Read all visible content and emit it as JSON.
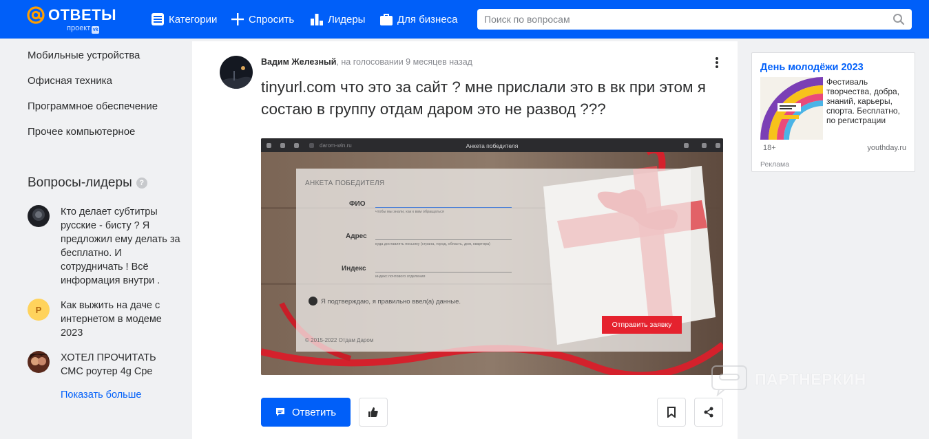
{
  "header": {
    "logo_text": "ОТВЕТЫ",
    "logo_sub": "проект",
    "logo_sub_badge": "vk",
    "nav": [
      {
        "label": "Категории",
        "icon": "categories-icon"
      },
      {
        "label": "Спросить",
        "icon": "plus-icon"
      },
      {
        "label": "Лидеры",
        "icon": "leaders-icon"
      },
      {
        "label": "Для бизнеса",
        "icon": "briefcase-icon"
      }
    ],
    "search_placeholder": "Поиск по вопросам",
    "search_value": ""
  },
  "sidebar": {
    "categories": [
      "Мобильные устройства",
      "Офисная техника",
      "Программное обеспечение",
      "Прочее компьютерное"
    ],
    "leaders_title": "Вопросы-лидеры",
    "help_mark": "?",
    "leaders": [
      {
        "text": "Кто делает субтитры русские - бисту ? Я предложил ему делать за бесплатно. И сотрудничать ! Всё информация внутри ."
      },
      {
        "text": "Как выжить на даче с интернетом в модеме 2023",
        "avatar_letter": "Р"
      },
      {
        "text": "ХОТЕЛ ПРОЧИТАТЬ СМС роутер 4g Сре"
      }
    ],
    "show_more": "Показать больше"
  },
  "question": {
    "author": "Вадим Железный",
    "meta": ", на голосовании 9 месяцев назад",
    "title": "tinyurl.com что это за сайт ? мне прислали это в вк при этом я состаю в группу отдам даром это не развод ???",
    "screenshot": {
      "url": "darom-win.ru",
      "tab_title": "Анкета победителя",
      "form_head": "АНКЕТА ПОБЕДИТЕЛЯ",
      "fields": [
        {
          "label": "ФИО",
          "hint": "чтобы мы знали, как к вам обращаться"
        },
        {
          "label": "Адрес",
          "hint": "куда доставлять посылку (страна, город, область, дом, квартира)"
        },
        {
          "label": "Индекс",
          "hint": "индекс почтового отделения"
        }
      ],
      "confirm": "Я подтверждаю, я правильно ввел(а) данные.",
      "submit": "Отправить заявку",
      "copyright": "© 2015-2022 Отдам Даром"
    },
    "answer_button": "Ответить"
  },
  "ad": {
    "title": "День молодёжи 2023",
    "text": "Фестиваль творчества, добра, знаний, карьеры, спорта. Бесплатно, по регистрации",
    "age": "18+",
    "domain": "youthday.ru",
    "label": "Реклама"
  },
  "watermark": "ПАРТНЕРКИН",
  "colors": {
    "brand": "#005ff9",
    "page_bg": "#f0f1f3",
    "text": "#2c2d2e",
    "muted": "#87898f",
    "submit_red": "#e5222e"
  }
}
